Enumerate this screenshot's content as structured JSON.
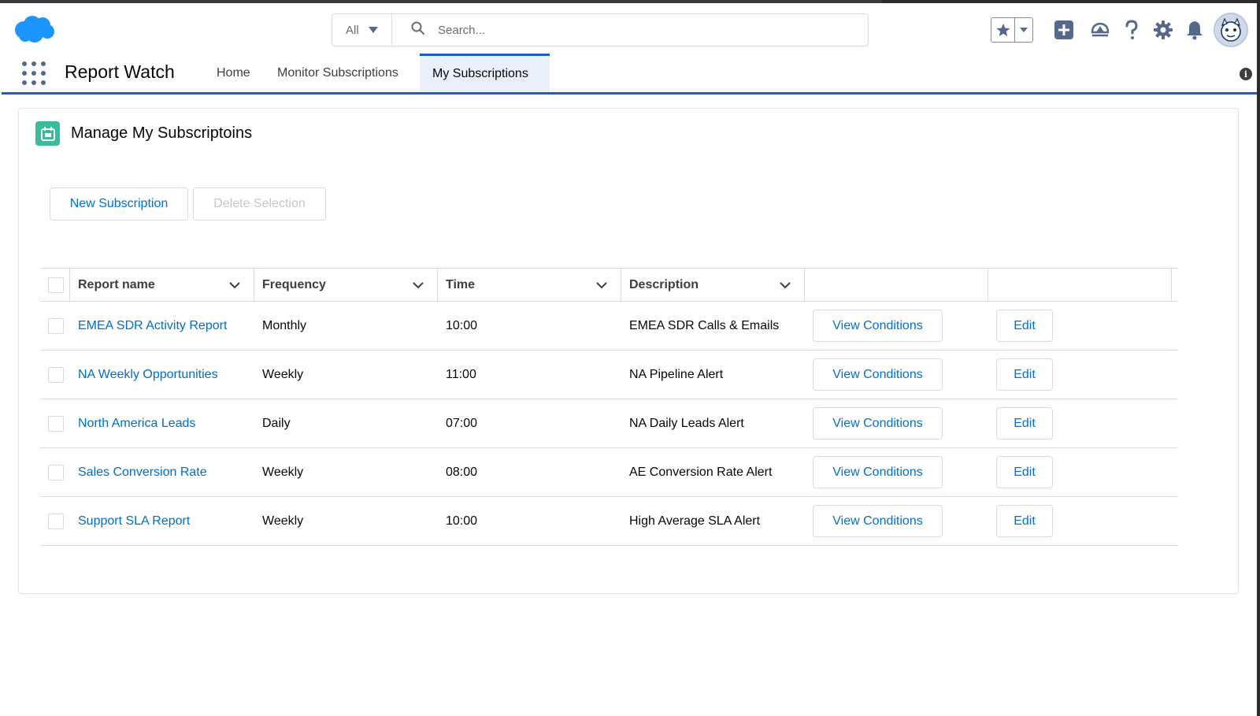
{
  "header": {
    "search_scope": "All",
    "search_placeholder": "Search..."
  },
  "icons": {
    "logo": "salesforce-cloud-logo",
    "favorites": "star-icon",
    "add": "plus-icon",
    "trailhead": "trailhead-icon",
    "help": "question-icon",
    "setup": "gear-icon",
    "notifications": "bell-icon",
    "avatar": "user-avatar"
  },
  "colors": {
    "brand": "#1f5cbf",
    "link": "#006dcc",
    "card_icon": "#3bba9c",
    "logo": "#1b96ff"
  },
  "app_nav": {
    "app_name": "Report Watch",
    "tabs": [
      {
        "label": "Home",
        "active": false
      },
      {
        "label": "Monitor Subscriptions",
        "active": false
      },
      {
        "label": "My Subscriptions",
        "active": true
      }
    ]
  },
  "card": {
    "title": "Manage My Subscriptoins",
    "new_button": "New Subscription",
    "delete_button": "Delete Selection"
  },
  "table": {
    "columns": [
      "Report name",
      "Frequency",
      "Time",
      "Description"
    ],
    "rows": [
      {
        "report": "EMEA SDR Activity Report",
        "frequency": "Monthly",
        "time": "10:00",
        "description": "EMEA SDR Calls & Emails",
        "view": "View Conditions",
        "edit": "Edit"
      },
      {
        "report": "NA Weekly Opportunities",
        "frequency": "Weekly",
        "time": "11:00",
        "description": "NA Pipeline Alert",
        "view": "View Conditions",
        "edit": "Edit"
      },
      {
        "report": "North America Leads",
        "frequency": "Daily",
        "time": "07:00",
        "description": "NA Daily Leads Alert",
        "view": "View Conditions",
        "edit": "Edit"
      },
      {
        "report": "Sales Conversion Rate",
        "frequency": "Weekly",
        "time": "08:00",
        "description": "AE Conversion Rate Alert",
        "view": "View Conditions",
        "edit": "Edit"
      },
      {
        "report": "Support SLA Report",
        "frequency": "Weekly",
        "time": "10:00",
        "description": "High Average SLA Alert",
        "view": "View Conditions",
        "edit": "Edit"
      }
    ]
  }
}
